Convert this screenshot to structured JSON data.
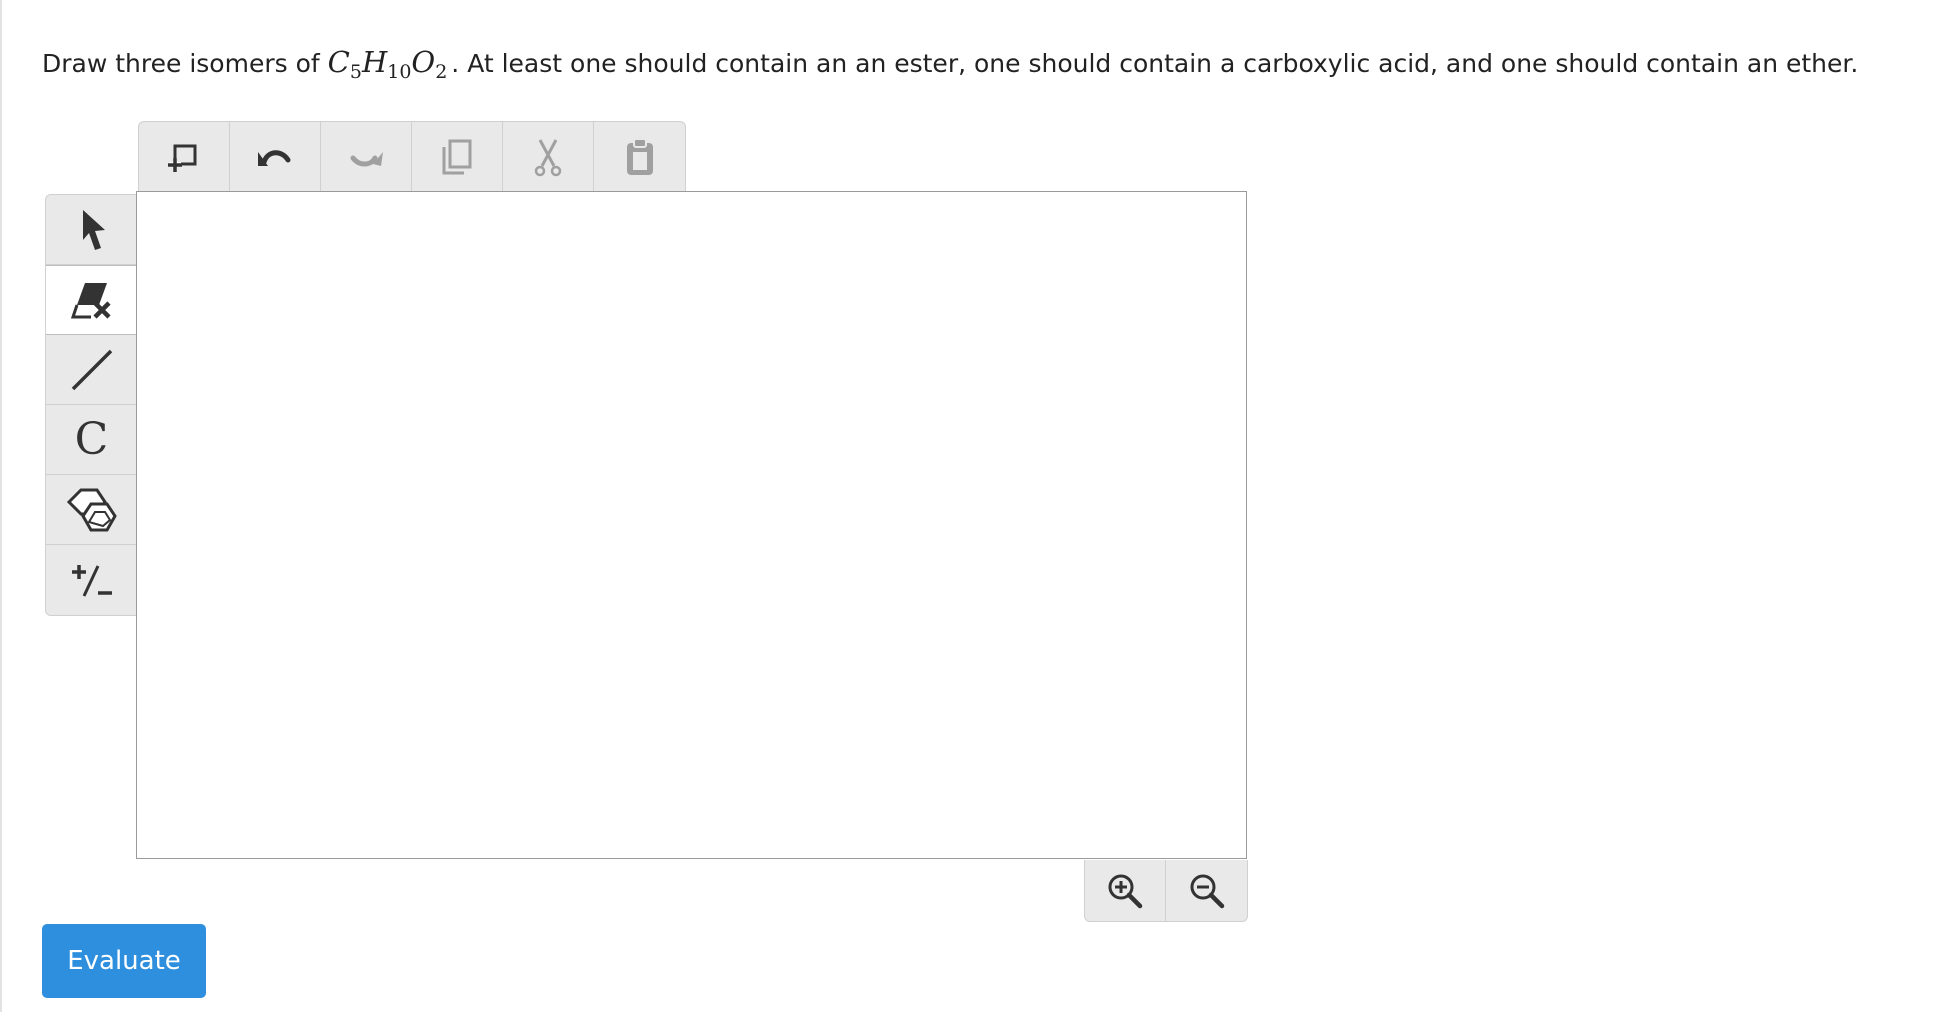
{
  "question": {
    "prefix": "Draw three isomers of",
    "formula": {
      "c": "C",
      "c_sub": "5",
      "h": "H",
      "h_sub": "10",
      "o": "O",
      "o_sub": "2"
    },
    "suffix": ". At least one should contain an an ester, one should contain a carboxylic acid, and one should contain an ether."
  },
  "toolbar": {
    "icons": [
      "new-structure-icon",
      "undo-icon",
      "redo-icon",
      "copy-icon",
      "cut-icon",
      "paste-icon"
    ]
  },
  "sidebar": {
    "icons": [
      "select-arrow-icon",
      "eraser-icon",
      "bond-icon",
      "carbon-atom",
      "ring-template-icon",
      "charge-icon"
    ],
    "active": "eraser-icon",
    "atom_label": "C",
    "charge_label": "+/-"
  },
  "zoom": {
    "icons": [
      "zoom-in-icon",
      "zoom-out-icon"
    ]
  },
  "evaluate_label": "Evaluate",
  "colors": {
    "accent": "#2f8fdf",
    "toolbar_bg": "#e9e9e9",
    "icon": "#333333",
    "icon_disabled": "#a0a0a0"
  }
}
